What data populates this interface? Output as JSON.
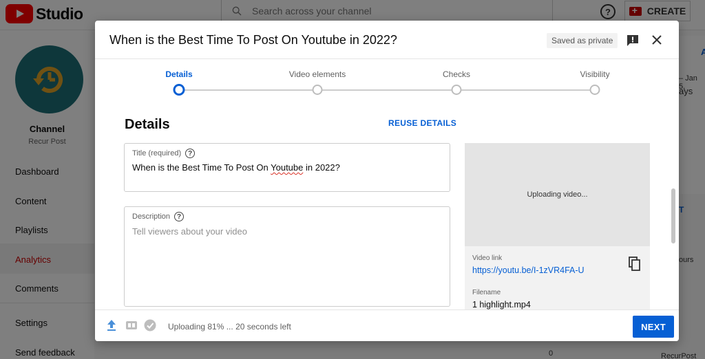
{
  "studio": {
    "logo_text": "Studio",
    "search_placeholder": "Search across your channel",
    "create_label": "CREATE",
    "channel": {
      "title": "Channel",
      "name": "Recur Post"
    },
    "nav": [
      "Dashboard",
      "Content",
      "Playlists",
      "Analytics",
      "Comments",
      "Settings",
      "Send feedback"
    ],
    "active_nav": "Analytics",
    "right_fragments": [
      "A",
      "– Jan 5,",
      "ays",
      "T",
      "ours",
      "0",
      "RecurPost Da"
    ]
  },
  "dialog": {
    "title": "When is the Best Time To Post On Youtube in 2022?",
    "saved_badge": "Saved as private",
    "steps": [
      {
        "label": "Details",
        "active": true
      },
      {
        "label": "Video elements",
        "active": false
      },
      {
        "label": "Checks",
        "active": false
      },
      {
        "label": "Visibility",
        "active": false
      }
    ],
    "section_title": "Details",
    "reuse_label": "REUSE DETAILS",
    "title_field": {
      "label": "Title (required)",
      "value_before": "When is the Best Time To Post On ",
      "value_misspelled": "Youtube",
      "value_after": " in 2022?"
    },
    "description_field": {
      "label": "Description",
      "placeholder": "Tell viewers about your video"
    },
    "preview": {
      "status": "Uploading video...",
      "link_label": "Video link",
      "link": "https://youtu.be/I-1zVR4FA-U",
      "filename_label": "Filename",
      "filename": "1 highlight.mp4"
    },
    "footer": {
      "upload_status": "Uploading 81% ... 20 seconds left",
      "upload_progress": 81,
      "next_label": "NEXT"
    }
  },
  "colors": {
    "accent": "#065fd4",
    "brand_red": "#ff0000",
    "avatar_bg": "#1d6f76",
    "avatar_clock": "#e0a326"
  }
}
